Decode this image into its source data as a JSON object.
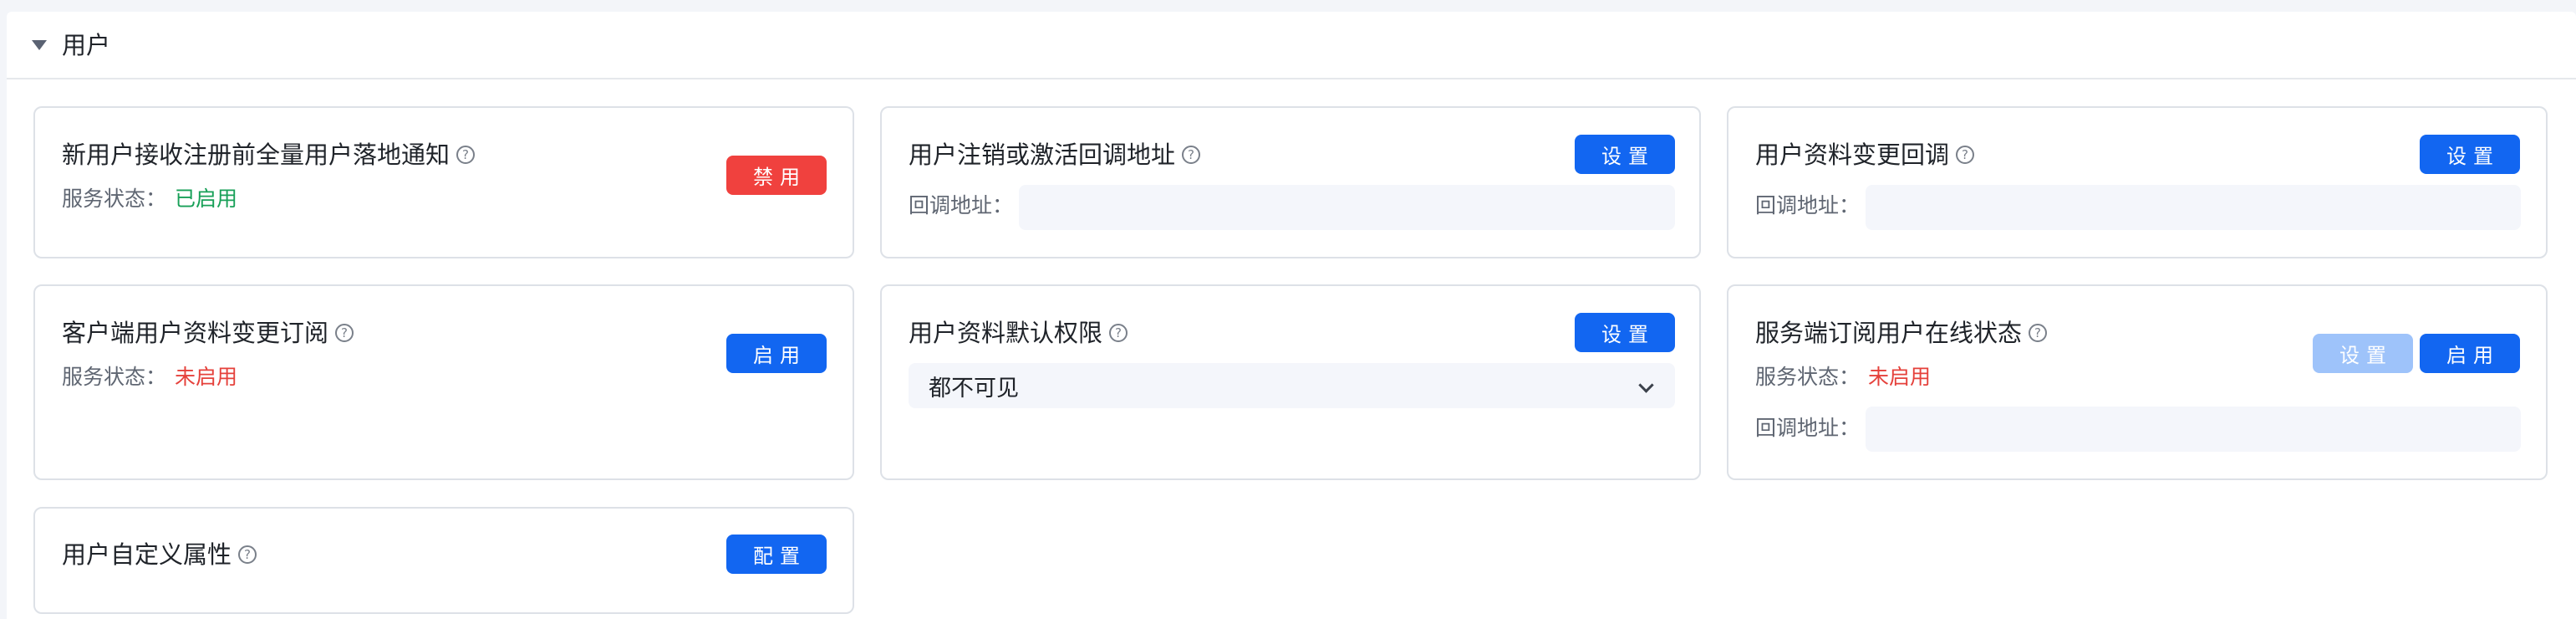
{
  "section": {
    "title": "用户"
  },
  "cards": {
    "notify_before_register": {
      "title": "新用户接收注册前全量用户落地通知",
      "status_label": "服务状态：",
      "status_value": "已启用",
      "button": "禁用"
    },
    "deactivate_callback": {
      "title": "用户注销或激活回调地址",
      "button": "设置",
      "field_label": "回调地址：",
      "field_value": ""
    },
    "profile_change_callback": {
      "title": "用户资料变更回调",
      "button": "设置",
      "field_label": "回调地址：",
      "field_value": ""
    },
    "client_profile_subscribe": {
      "title": "客户端用户资料变更订阅",
      "status_label": "服务状态：",
      "status_value": "未启用",
      "button": "启用"
    },
    "profile_default_permission": {
      "title": "用户资料默认权限",
      "button": "设置",
      "selected_option": "都不可见"
    },
    "server_online_subscribe": {
      "title": "服务端订阅用户在线状态",
      "status_label": "服务状态：",
      "status_value": "未启用",
      "button_set": "设置",
      "button_enable": "启用",
      "field_label": "回调地址：",
      "field_value": ""
    },
    "custom_attributes": {
      "title": "用户自定义属性",
      "button": "配置"
    }
  },
  "colors": {
    "primary": "#1266f1",
    "danger": "#f0413e",
    "disabled": "#9ec3fa",
    "status_on": "#18a058",
    "status_off": "#e5413b"
  },
  "icons": {
    "help": "question-circle",
    "caret": "caret-down"
  }
}
